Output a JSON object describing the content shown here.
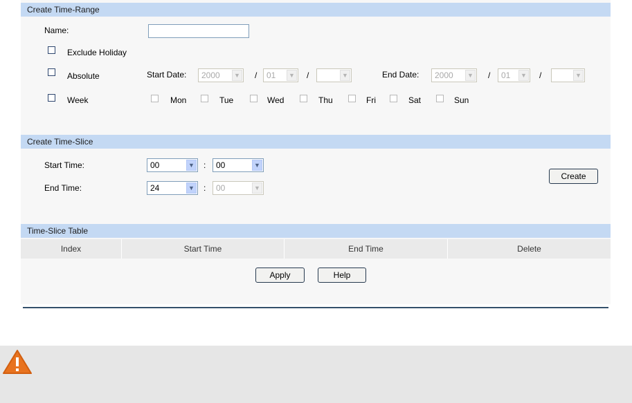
{
  "time_range": {
    "header": "Create Time-Range",
    "name_label": "Name:",
    "name_value": "",
    "exclude_holiday_label": "Exclude Holiday",
    "absolute_label": "Absolute",
    "start_date_label": "Start Date:",
    "end_date_label": "End Date:",
    "start_year": "2000",
    "start_month": "01",
    "start_day": "",
    "end_year": "2000",
    "end_month": "01",
    "end_day": "",
    "separator": "/",
    "week_label": "Week",
    "days": [
      "Mon",
      "Tue",
      "Wed",
      "Thu",
      "Fri",
      "Sat",
      "Sun"
    ]
  },
  "time_slice": {
    "header": "Create Time-Slice",
    "start_time_label": "Start Time:",
    "end_time_label": "End Time:",
    "start_hour": "00",
    "start_minute": "00",
    "end_hour": "24",
    "end_minute": "00",
    "colon": ":",
    "create_button": "Create"
  },
  "table": {
    "header": "Time-Slice Table",
    "columns": [
      "Index",
      "Start Time",
      "End Time",
      "Delete"
    ]
  },
  "buttons": {
    "apply": "Apply",
    "help": "Help"
  },
  "icons": {
    "warning": "warning-triangle-icon"
  },
  "colors": {
    "section_bar": "#c4d9f3",
    "warning": "#e8731f"
  }
}
